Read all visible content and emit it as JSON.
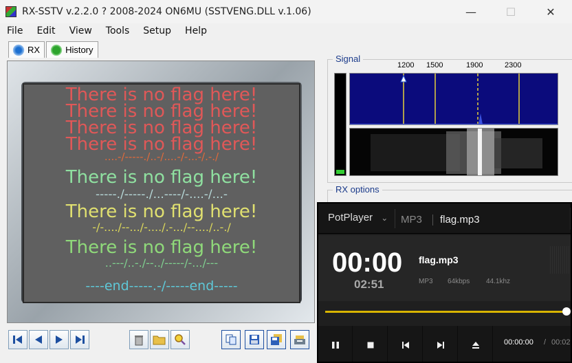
{
  "window": {
    "title": "RX-SSTV v.2.2.0 ? 2008-2024 ON6MU (SSTVENG.DLL v.1.06)",
    "minimize_glyph": "—",
    "maximize_glyph": "☐",
    "close_glyph": "✕"
  },
  "menu": [
    "File",
    "Edit",
    "View",
    "Tools",
    "Setup",
    "Help"
  ],
  "tabs": [
    {
      "label": "RX",
      "icon": "antenna-icon"
    },
    {
      "label": "History",
      "icon": "history-icon"
    }
  ],
  "sstv_image": {
    "lines": [
      {
        "text": "There is no flag here!",
        "color": "#e05858"
      },
      {
        "text": "There is no flag here!",
        "color": "#e05858"
      },
      {
        "text": "There is no flag here!",
        "color": "#e05858"
      },
      {
        "text": "There is no flag here!",
        "color": "#e05858"
      },
      {
        "text": "....-/-----./..-/....-/-...-/.-./",
        "color": "#e06a3a"
      },
      {
        "text": "There is no flag here!",
        "color": "#8fe0a0"
      },
      {
        "text": "-----./-----./...----/-....-/...-",
        "color": "#b7d9d9"
      },
      {
        "text": "There is no flag here!",
        "color": "#e0e070"
      },
      {
        "text": "-/-..../--.../-..../.-.../--..../..-./",
        "color": "#dcd85a"
      },
      {
        "text": "There is no flag here!",
        "color": "#8fd97a"
      },
      {
        "text": "..---/..-./--../-----/-.../---",
        "color": "#7fd08f"
      },
      {
        "text": "----end-----.-/-----end-----",
        "color": "#5ec8d8"
      }
    ]
  },
  "left_toolbar": [
    {
      "name": "first-button",
      "icon": "skip-first-icon"
    },
    {
      "name": "prev-button",
      "icon": "prev-icon"
    },
    {
      "name": "next-button",
      "icon": "next-icon"
    },
    {
      "name": "last-button",
      "icon": "skip-last-icon"
    },
    {
      "name": "trash-button",
      "icon": "trash-icon"
    },
    {
      "name": "open-folder-button",
      "icon": "folder-icon"
    },
    {
      "name": "zoom-button",
      "icon": "magnifier-icon"
    },
    {
      "name": "copy-button",
      "icon": "copy-icon"
    },
    {
      "name": "save-button",
      "icon": "floppy-icon"
    },
    {
      "name": "save-as-button",
      "icon": "floppy-stack-icon"
    },
    {
      "name": "settings-button",
      "icon": "tools-icon"
    }
  ],
  "signal": {
    "legend": "Signal",
    "freq_labels": [
      "1200",
      "1500",
      "1900",
      "2300"
    ],
    "level_fraction": 0.04
  },
  "rx_options": {
    "legend": "RX options"
  },
  "potplayer": {
    "brand": "PotPlayer",
    "dropdown_glyph": "⌄",
    "format": "MP3",
    "filename": "flag.mp3",
    "time_current_big": "00:00",
    "duration_big": "02:51",
    "info_name": "flag.mp3",
    "info_codec": "MP3",
    "info_bitrate": "64kbps",
    "info_samplerate": "44.1khz",
    "seek_fraction": 1.0,
    "time_current": "00:00:00",
    "time_slash": "/",
    "time_total": "00:02",
    "colors": {
      "accent": "#d8b400"
    },
    "controls": [
      {
        "name": "pause-button",
        "icon": "pause-icon"
      },
      {
        "name": "stop-button",
        "icon": "stop-icon"
      },
      {
        "name": "previous-track-button",
        "icon": "previous-icon"
      },
      {
        "name": "next-track-button",
        "icon": "next-icon"
      },
      {
        "name": "eject-button",
        "icon": "eject-icon"
      }
    ]
  }
}
